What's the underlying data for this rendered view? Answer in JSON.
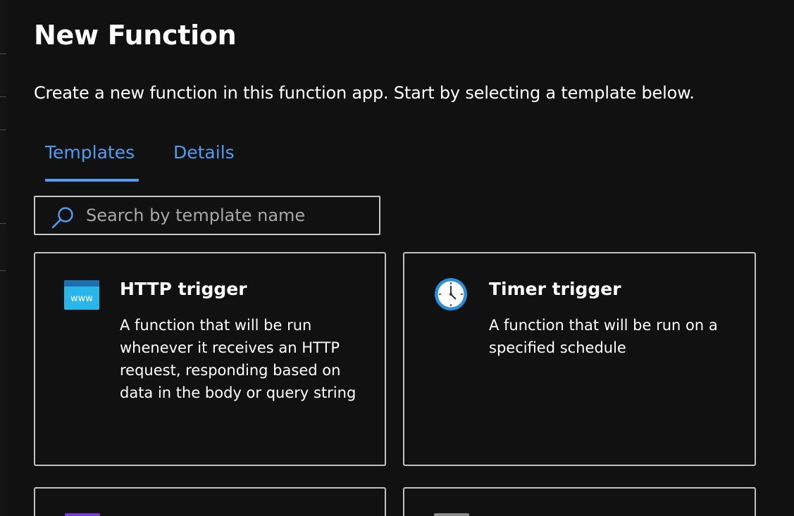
{
  "page": {
    "title": "New Function",
    "description": "Create a new function in this function app. Start by selecting a template below."
  },
  "tabs": [
    {
      "label": "Templates",
      "selected": true
    },
    {
      "label": "Details",
      "selected": false
    }
  ],
  "search": {
    "value": "",
    "placeholder": "Search by template name",
    "icon": "search-icon"
  },
  "templates": [
    {
      "title": "HTTP trigger",
      "description": "A function that will be run whenever it receives an HTTP request, responding based on data in the body or query string",
      "icon": "www-browser-icon",
      "icon_label": "www"
    },
    {
      "title": "Timer trigger",
      "description": "A function that will be run on a specified schedule",
      "icon": "clock-icon"
    },
    {
      "title": "",
      "description": "",
      "icon": "purple-template-icon"
    },
    {
      "title": "",
      "description": "",
      "icon": "gray-template-icon"
    }
  ],
  "colors": {
    "background": "#111111",
    "accent": "#4f9cf0",
    "card_border": "#c2c2c2",
    "http_icon": "#29b6e8",
    "timer_icon": "#2a8fd8"
  }
}
